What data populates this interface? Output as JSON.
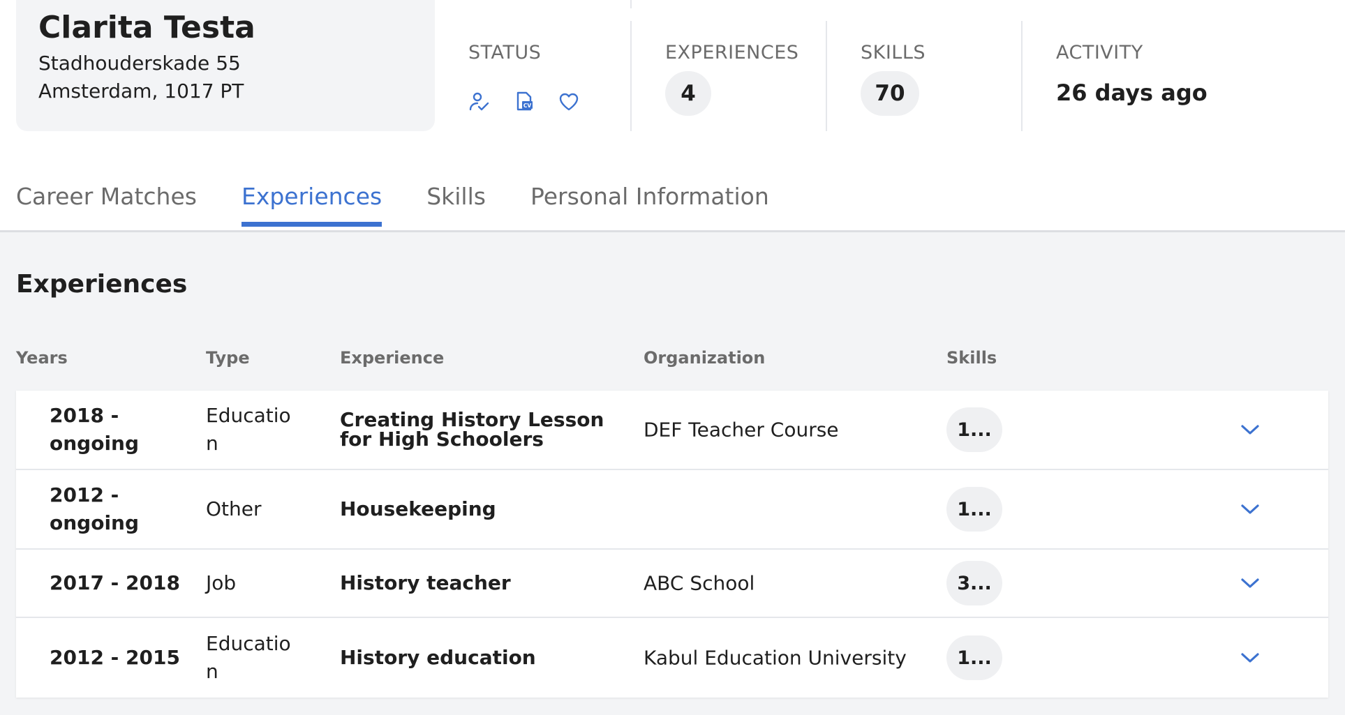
{
  "profile": {
    "name": "Clarita Testa",
    "address": "Stadhouderskade 55",
    "city": "Amsterdam, 1017 PT"
  },
  "stats": {
    "status_label": "STATUS",
    "status_icons": [
      "user-check-icon",
      "cv-document-icon",
      "heart-icon"
    ],
    "experiences_label": "EXPERIENCES",
    "experiences_count": "4",
    "skills_label": "SKILLS",
    "skills_count": "70",
    "activity_label": "ACTIVITY",
    "activity_value": "26 days ago"
  },
  "tabs": [
    {
      "label": "Career Matches",
      "active": false
    },
    {
      "label": "Experiences",
      "active": true
    },
    {
      "label": "Skills",
      "active": false
    },
    {
      "label": "Personal Information",
      "active": false
    }
  ],
  "section": {
    "title": "Experiences",
    "columns": [
      "Years",
      "Type",
      "Experience",
      "Organization",
      "Skills"
    ]
  },
  "rows": [
    {
      "years": "2018 - ongoing",
      "type": "Education",
      "experience": "Creating History Lesson for High Schoolers",
      "organization": "DEF Teacher Course",
      "skills": "1..."
    },
    {
      "years": "2012 - ongoing",
      "type": "Other",
      "experience": "Housekeeping",
      "organization": "",
      "skills": "1..."
    },
    {
      "years": "2017 - 2018",
      "type": "Job",
      "experience": "History teacher",
      "organization": "ABC School",
      "skills": "3..."
    },
    {
      "years": "2012 - 2015",
      "type": "Education",
      "experience": "History education",
      "organization": "Kabul Education University",
      "skills": "1..."
    }
  ],
  "colors": {
    "accent": "#3c72d0",
    "panel": "#f3f4f6",
    "muted_text": "#6b6b6b"
  }
}
